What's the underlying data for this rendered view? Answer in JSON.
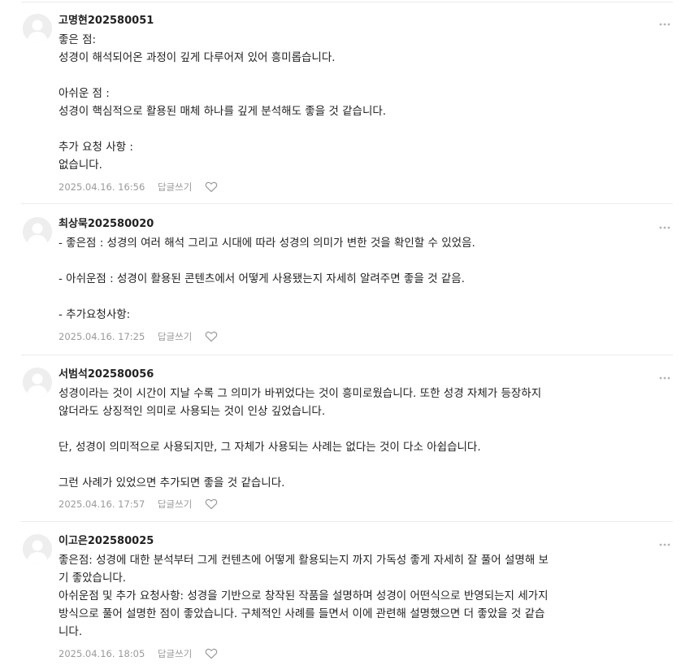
{
  "comments": [
    {
      "author": "고명현202580051",
      "lines": [
        "좋은 점:",
        "성경이 해석되어온 과정이 깊게 다루어져 있어 흥미롭습니다.",
        "",
        "아쉬운 점 :",
        "성경이 핵심적으로 활용된 매체 하나를 깊게 분석해도 좋을 것 같습니다.",
        "",
        "추가 요청 사항 :",
        "없습니다."
      ],
      "date": "2025.04.16. 16:56",
      "reply_label": "답글쓰기"
    },
    {
      "author": "최상묵202580020",
      "lines": [
        "- 좋은점 : 성경의 여러 해석 그리고 시대에 따라 성경의 의미가 변한 것을 확인할 수 있었음.",
        "",
        "- 아쉬운점 : 성경이 활용된 콘텐츠에서 어떻게 사용됐는지 자세히 알려주면 좋을 것 같음.",
        "",
        "- 추가요청사항:"
      ],
      "date": "2025.04.16. 17:25",
      "reply_label": "답글쓰기"
    },
    {
      "author": "서범석202580056",
      "lines": [
        "성경이라는 것이 시간이 지날 수록 그 의미가 바뀌었다는 것이 흥미로웠습니다. 또한 성경 자체가 등장하지",
        "않더라도 상징적인 의미로 사용되는 것이 인상 깊었습니다.",
        "",
        "단, 성경이 의미적으로 사용되지만, 그 자체가 사용되는 사례는 없다는 것이 다소 아쉽습니다.",
        "",
        "그런 사례가 있었으면 추가되면 좋을 것 같습니다."
      ],
      "date": "2025.04.16. 17:57",
      "reply_label": "답글쓰기"
    },
    {
      "author": "이고은202580025",
      "lines": [
        "좋은점: 성경에 대한 분석부터 그게 컨텐츠에 어떻게 활용되는지 까지 가독성 좋게 자세히 잘 풀어 설명해 보",
        "기 좋았습니다.",
        "아쉬운점 및 추가 요청사항: 성경을 기반으로 창작된 작품을 설명하며 성경이 어떤식으로 반영되는지 세가지",
        "방식으로 풀어 설명한 점이 좋았습니다. 구체적인 사례를 들면서 이에 관련해 설명했으면 더 좋았을 것 같습",
        "니다."
      ],
      "date": "2025.04.16. 18:05",
      "reply_label": "답글쓰기"
    }
  ],
  "icons": {
    "avatar": "default-avatar-icon",
    "more": "more-dots-icon",
    "like": "heart-outline-icon"
  },
  "colors": {
    "text": "#222222",
    "meta": "#9a9a9a",
    "divider": "#ebebeb",
    "avatar_bg": "#eeeeee",
    "avatar_fg": "#ffffff"
  }
}
